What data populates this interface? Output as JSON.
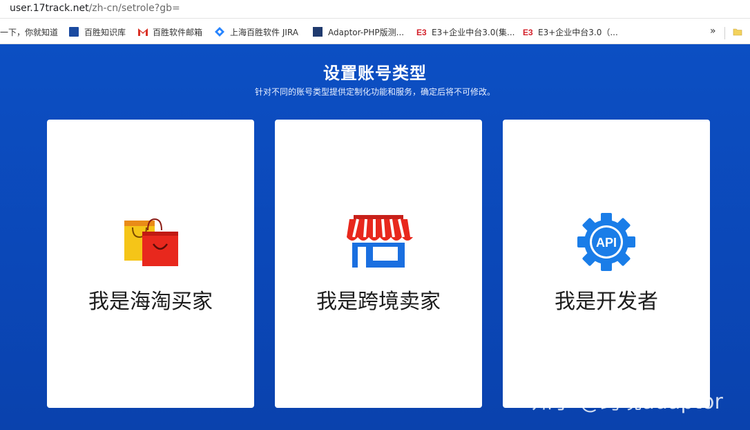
{
  "browser": {
    "url_host": "user.17track.net",
    "url_path": "/zh-cn/setrole?gb="
  },
  "bookmarks": [
    {
      "label": "一下，你就知道",
      "icon": "none"
    },
    {
      "label": "百胜知识库",
      "icon": "doc-icon"
    },
    {
      "label": "百胜软件邮箱",
      "icon": "gmail-icon"
    },
    {
      "label": "上海百胜软件 JIRA",
      "icon": "jira-icon"
    },
    {
      "label": "Adaptor-PHP版测...",
      "icon": "idaas-icon"
    },
    {
      "label": "E3+企业中台3.0(集...",
      "icon": "e3-icon"
    },
    {
      "label": "E3+企业中台3.0（...",
      "icon": "e3-icon"
    }
  ],
  "bookmarks_more": "»",
  "bookmarks_overflow": "",
  "page": {
    "title": "设置账号类型",
    "subtitle": "针对不同的账号类型提供定制化功能和服务，确定后将不可修改。"
  },
  "cards": [
    {
      "label": "我是海淘买家",
      "icon": "shopping-bags-icon"
    },
    {
      "label": "我是跨境卖家",
      "icon": "storefront-icon"
    },
    {
      "label": "我是开发者",
      "icon": "api-gear-icon",
      "icon_text": "API"
    }
  ],
  "watermark": "知乎 @跨境adaptor",
  "colors": {
    "background": "#0b4abc",
    "card": "#ffffff",
    "bag_yellow": "#f5c518",
    "bag_red": "#e8281d",
    "store_red": "#e8281d",
    "store_blue": "#1a6fe0",
    "gear_blue": "#1a7de8"
  }
}
